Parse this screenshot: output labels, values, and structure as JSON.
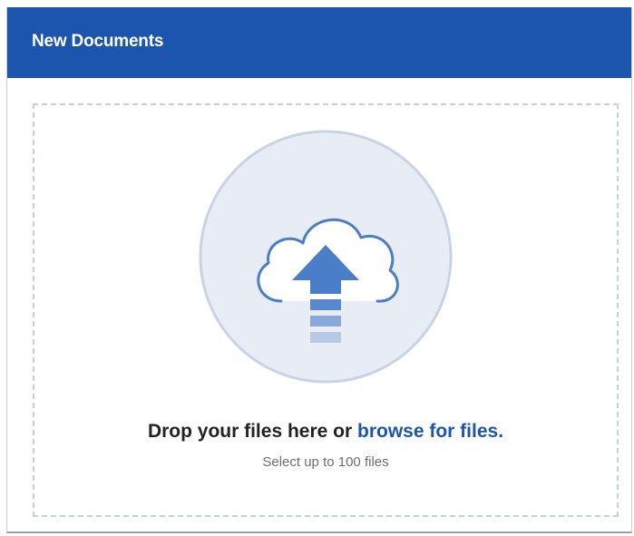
{
  "header": {
    "title": "New Documents"
  },
  "dropzone": {
    "drop_text": "Drop your files here or",
    "browse_link": "browse for files.",
    "hint": "Select up to 100 files",
    "icon": "cloud-upload-icon"
  },
  "colors": {
    "header_bg": "#1c55ad",
    "link": "#1c55ad",
    "dashed_border": "#c3cfe0",
    "circle_fill": "#e8edf5",
    "circle_stroke": "#c8d4e6",
    "icon_blue": "#4a7ec8"
  }
}
